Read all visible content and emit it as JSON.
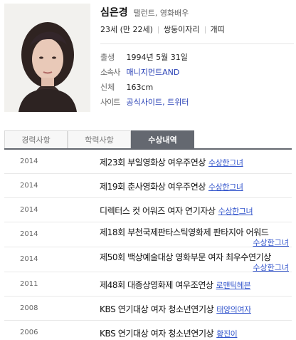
{
  "profile": {
    "name": "심은경",
    "roles": "탤런트, 영화배우",
    "age": "23세 (만 22세)",
    "zodiac_sign": "쌍둥이자리",
    "chinese_zodiac": "개띠",
    "details": [
      {
        "label": "출생",
        "value": "1994년 5월 31일"
      },
      {
        "label": "소속사",
        "value": "매니지먼트AND"
      },
      {
        "label": "신체",
        "value": "163cm"
      },
      {
        "label": "사이트",
        "value": "공식사이트, 트위터"
      }
    ]
  },
  "tabs": [
    {
      "label": "경력사항",
      "active": false
    },
    {
      "label": "학력사항",
      "active": false
    },
    {
      "label": "수상내역",
      "active": true
    }
  ],
  "awards": [
    {
      "year": "2014",
      "title": "제23회 부일영화상 여우주연상",
      "work": "수상한그녀"
    },
    {
      "year": "2014",
      "title": "제19회 춘사영화상 여우주연상",
      "work": "수상한그녀"
    },
    {
      "year": "2014",
      "title": "디렉터스 컷 어워즈 여자 연기자상",
      "work": "수상한그녀"
    },
    {
      "year": "2014",
      "title": "제18회 부천국제판타스틱영화제 판타지아 어워드",
      "work": "수상한그녀"
    },
    {
      "year": "2014",
      "title": "제50회 백상예술대상 영화부문 여자 최우수연기상",
      "work": "수상한그녀"
    },
    {
      "year": "2011",
      "title": "제48회 대종상영화제 여우조연상",
      "work": "로맨틱헤븐"
    },
    {
      "year": "2008",
      "title": "KBS 연기대상 여자 청소년연기상",
      "work": "태양의여자"
    },
    {
      "year": "2006",
      "title": "KBS 연기대상 여자 청소년연기상",
      "work": "황진이"
    }
  ],
  "colors": {
    "tab_active": "#646870",
    "link": "#2840b5",
    "work": "#3355cc"
  }
}
